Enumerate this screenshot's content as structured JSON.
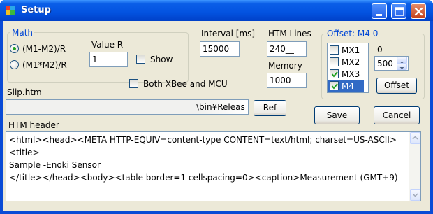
{
  "window": {
    "title": "Setup"
  },
  "math": {
    "legend": "Math",
    "option1": "(M1-M2)/R",
    "option2": "(M1*M2)/R",
    "selected": "(M1-M2)/R",
    "value_r_label": "Value R",
    "value_r": "1",
    "show_label": "Show",
    "show_checked": false
  },
  "interval": {
    "label": "Interval [ms]",
    "value": "15000"
  },
  "htm_lines": {
    "label": "HTM Lines",
    "value": "240__"
  },
  "memory": {
    "label": "Memory",
    "value": "1000_"
  },
  "both_xbee": {
    "label": "Both XBee and MCU",
    "checked": false
  },
  "offset": {
    "legend": "Offset: M4  0",
    "items": [
      {
        "label": "MX1",
        "checked": false
      },
      {
        "label": "MX2",
        "checked": false
      },
      {
        "label": "MX3",
        "checked": true
      },
      {
        "label": "M4",
        "checked": true,
        "selected": true
      }
    ],
    "value_label": "0",
    "spin_value": "500",
    "button": "Offset"
  },
  "slip": {
    "label": "Slip.htm",
    "path_visible": "\\bin¥Releas",
    "ref_button": "Ref"
  },
  "buttons": {
    "save": "Save",
    "cancel": "Cancel"
  },
  "htm_header": {
    "label": "HTM header",
    "text": "<html><head><META HTTP-EQUIV=content-type CONTENT=text/html; charset=US-ASCII><title>\nSample -Enoki Sensor\n</title></head><body><table border=1 cellspacing=0><caption>Measurement (GMT+9)"
  },
  "colors": {
    "titlebar": "#0353e0",
    "face": "#ece9d8",
    "group_legend": "#0046d5",
    "selection": "#316ac5"
  }
}
